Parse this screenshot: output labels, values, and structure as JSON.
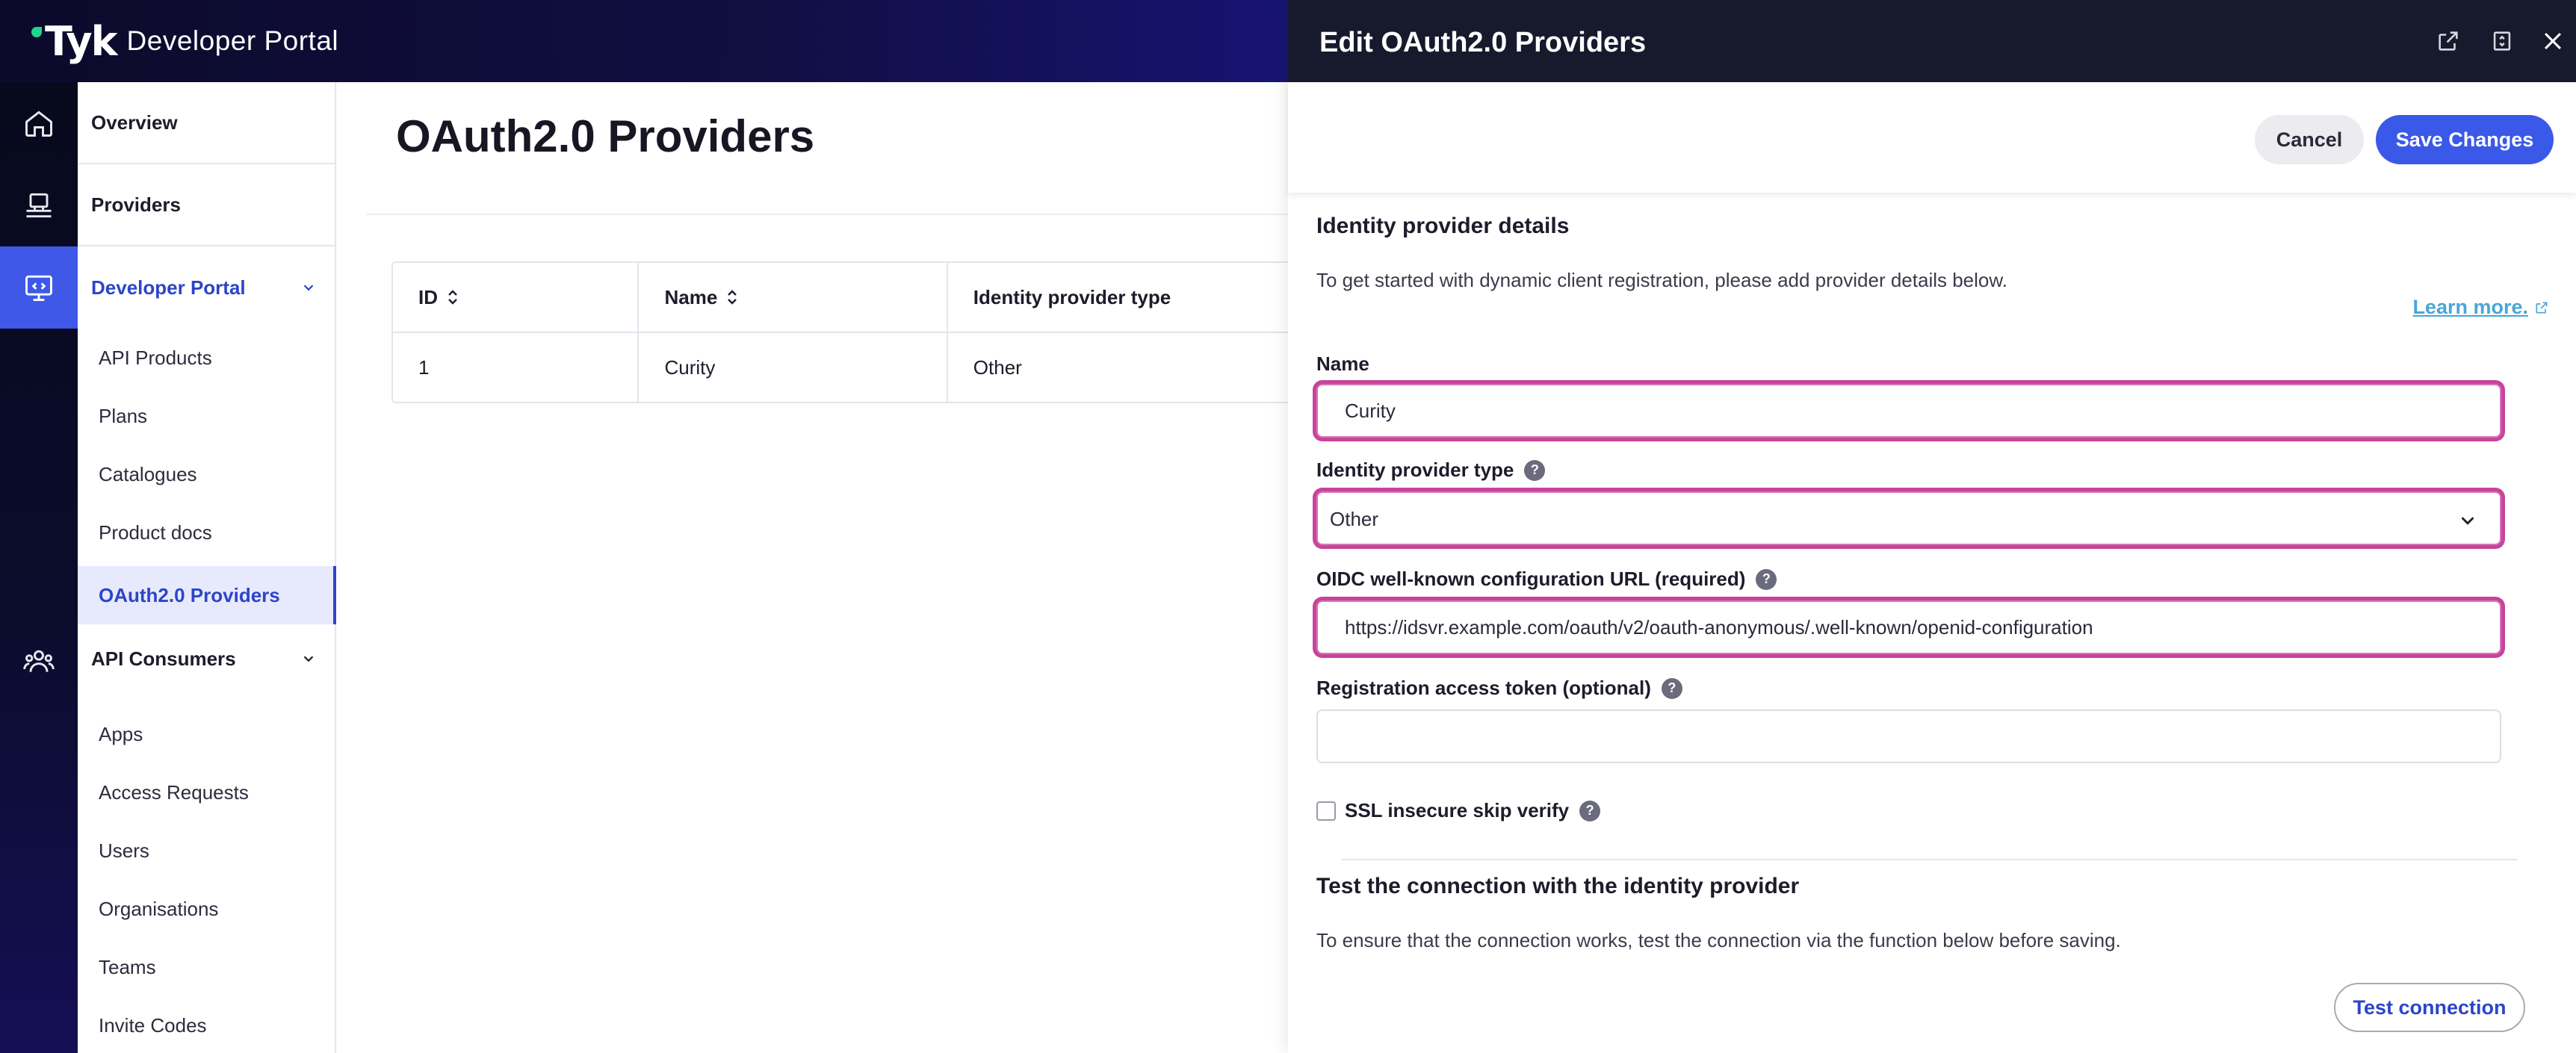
{
  "app": {
    "brand": "Tyk",
    "title": "Developer Portal"
  },
  "colors": {
    "accent": "#3a59e8",
    "highlight": "#c8439b",
    "link": "#4aa6d7"
  },
  "rail": {
    "icons": [
      "home-icon",
      "providers-icon",
      "developer-portal-icon",
      "consumers-icon"
    ]
  },
  "sidebar": {
    "overview": "Overview",
    "providers": "Providers",
    "developer_portal": "Developer Portal",
    "dev_items": [
      "API Products",
      "Plans",
      "Catalogues",
      "Product docs",
      "OAuth2.0 Providers"
    ],
    "api_consumers": "API Consumers",
    "consumer_items": [
      "Apps",
      "Access Requests",
      "Users",
      "Organisations",
      "Teams",
      "Invite Codes"
    ]
  },
  "main": {
    "title": "OAuth2.0 Providers",
    "columns": [
      "ID",
      "Name",
      "Identity provider type"
    ],
    "rows": [
      {
        "id": "1",
        "name": "Curity",
        "type": "Other"
      }
    ]
  },
  "drawer": {
    "title": "Edit OAuth2.0 Providers",
    "cancel": "Cancel",
    "save": "Save Changes",
    "details_title": "Identity provider details",
    "details_desc": "To get started with dynamic client registration, please add provider details below.",
    "learn_more": "Learn more.",
    "name_label": "Name",
    "name_value": "Curity",
    "type_label": "Identity provider type",
    "type_value": "Other",
    "oidc_label": "OIDC well-known configuration URL (required)",
    "oidc_value": "https://idsvr.example.com/oauth/v2/oauth-anonymous/.well-known/openid-configuration",
    "token_label": "Registration access token (optional)",
    "token_value": "",
    "ssl_label": "SSL insecure skip verify",
    "test_title": "Test the connection with the identity provider",
    "test_desc": "To ensure that the connection works, test the connection via the function below before saving.",
    "test_button": "Test connection",
    "help_glyph": "?"
  }
}
